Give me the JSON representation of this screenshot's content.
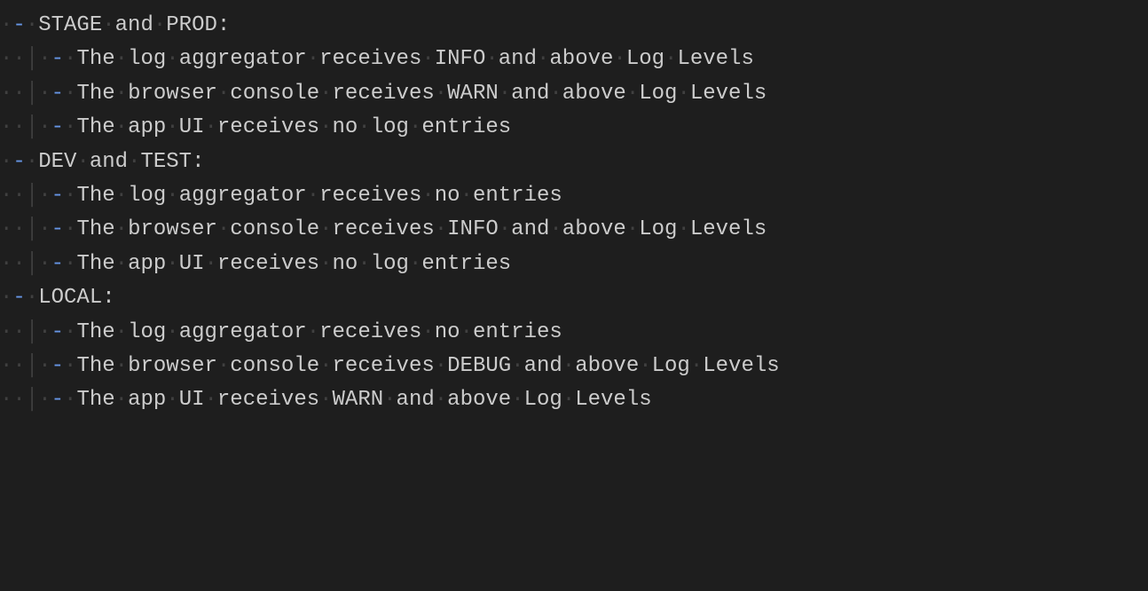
{
  "sections": [
    {
      "header_prefix": "STAGE",
      "header_mid": "and",
      "header_suffix": "PROD:",
      "items": [
        {
          "words": [
            "The",
            "log",
            "aggregator",
            "receives",
            "INFO",
            "and",
            "above",
            "Log",
            "Levels"
          ]
        },
        {
          "words": [
            "The",
            "browser",
            "console",
            "receives",
            "WARN",
            "and",
            "above",
            "Log",
            "Levels"
          ]
        },
        {
          "words": [
            "The",
            "app",
            "UI",
            "receives",
            "no",
            "log",
            "entries"
          ]
        }
      ]
    },
    {
      "header_prefix": "DEV",
      "header_mid": "and",
      "header_suffix": "TEST:",
      "items": [
        {
          "words": [
            "The",
            "log",
            "aggregator",
            "receives",
            "no",
            "entries"
          ]
        },
        {
          "words": [
            "The",
            "browser",
            "console",
            "receives",
            "INFO",
            "and",
            "above",
            "Log",
            "Levels"
          ]
        },
        {
          "words": [
            "The",
            "app",
            "UI",
            "receives",
            "no",
            "log",
            "entries"
          ]
        }
      ]
    },
    {
      "header_prefix": "LOCAL:",
      "header_mid": "",
      "header_suffix": "",
      "items": [
        {
          "words": [
            "The",
            "log",
            "aggregator",
            "receives",
            "no",
            "entries"
          ]
        },
        {
          "words": [
            "The",
            "browser",
            "console",
            "receives",
            "DEBUG",
            "and",
            "above",
            "Log",
            "Levels"
          ]
        },
        {
          "words": [
            "The",
            "app",
            "UI",
            "receives",
            "WARN",
            "and",
            "above",
            "Log",
            "Levels"
          ]
        }
      ]
    }
  ],
  "glyphs": {
    "dash": "-",
    "dot": "·",
    "guide": "│"
  }
}
